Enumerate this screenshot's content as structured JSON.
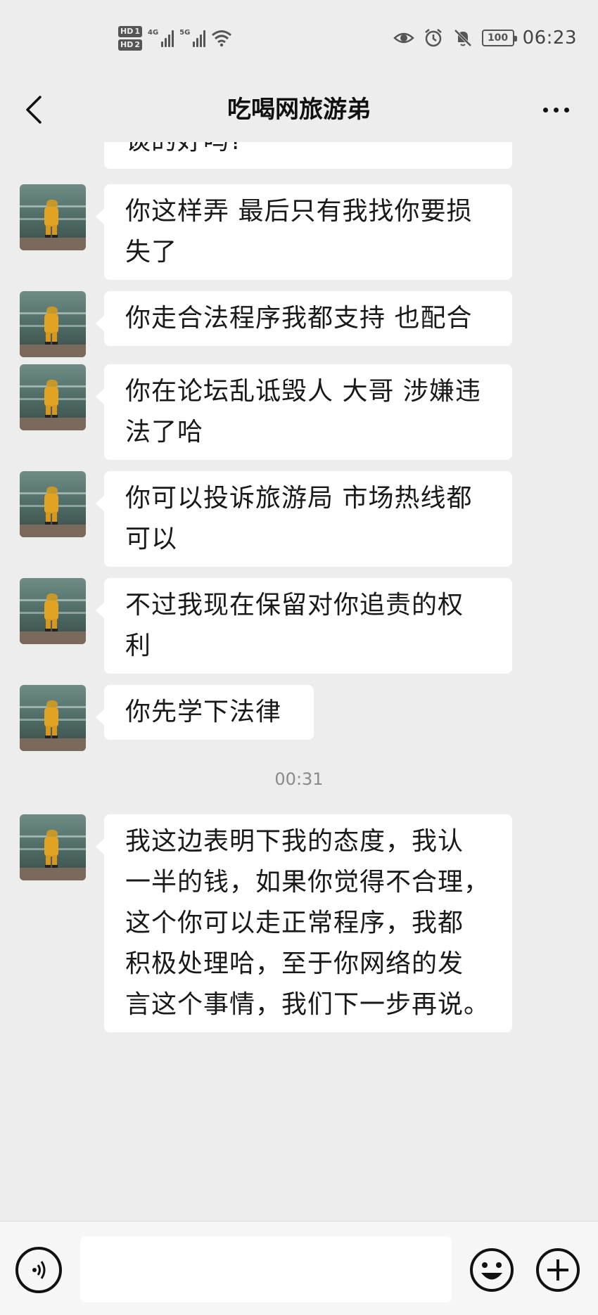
{
  "status_bar": {
    "sim1_label": "HD",
    "sim1_num": "1",
    "sim2_label": "HD",
    "sim2_num": "2",
    "net1_label": "4G",
    "net2_label": "5G",
    "battery": "100",
    "time": "06:23",
    "icons": [
      "eye-icon",
      "alarm-icon",
      "mute-icon",
      "wifi-icon"
    ]
  },
  "header": {
    "title": "吃喝网旅游弟"
  },
  "messages": [
    {
      "lines": [
        "谈的好吗?"
      ]
    },
    {
      "lines": [
        "你这样弄 最后只有我找你要损",
        "失了"
      ]
    },
    {
      "lines": [
        "你走合法程序我都支持 也配合"
      ]
    },
    {
      "lines": [
        "你在论坛乱诋毁人 大哥 涉嫌违",
        "法了哈"
      ]
    },
    {
      "lines": [
        "你可以投诉旅游局 市场热线都",
        "可以"
      ]
    },
    {
      "lines": [
        "不过我现在保留对你追责的权",
        "利"
      ]
    },
    {
      "lines": [
        "你先学下法律"
      ]
    },
    {
      "lines": [
        "我这边表明下我的态度，我认",
        "一半的钱，如果你觉得不合理，",
        "这个你可以走正常程序，我都",
        "积极处理哈，至于你网络的发",
        "言这个事情，我们下一步再说。"
      ]
    }
  ],
  "time_separator": "00:31",
  "input": {
    "value": "",
    "placeholder": ""
  },
  "colors": {
    "background": "#ededed",
    "bubble": "#ffffff",
    "text": "#191919",
    "timestamp": "#8a8a8a"
  }
}
